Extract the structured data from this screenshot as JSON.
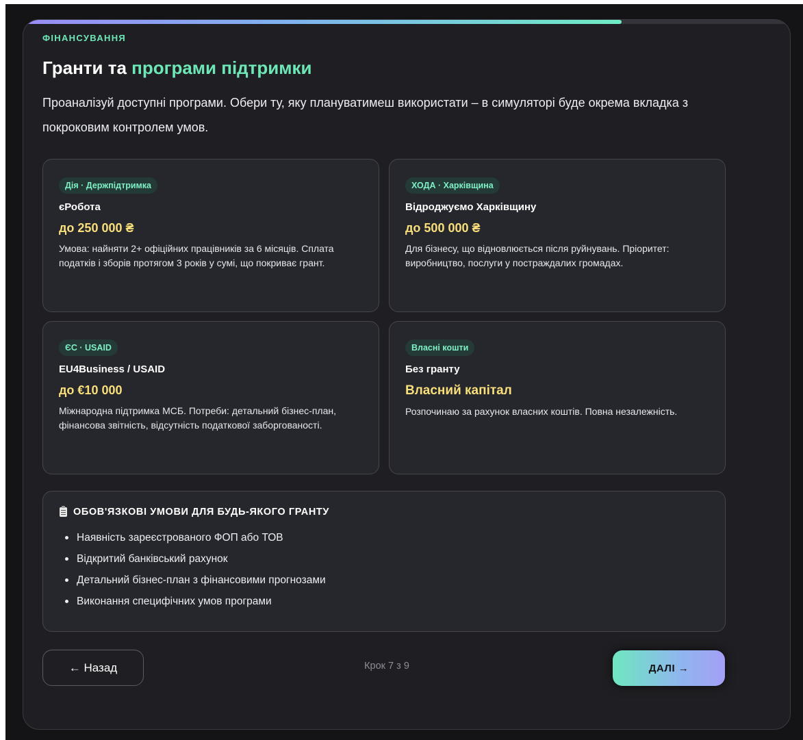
{
  "progress": {
    "fraction": 0.78
  },
  "header": {
    "eyebrow": "ФІНАНСУВАННЯ",
    "title_prefix": "Гранти та ",
    "title_accent": "програми підтримки",
    "lead": "Проаналізуй доступні програми. Обери ту, яку плануватимеш використати – в симуляторі буде окрема вкладка з покроковим контролем умов."
  },
  "options": [
    {
      "tag": "Дія · Держпідтримка",
      "name": "єРобота",
      "amount": "до 250 000 ₴",
      "desc": "Умова: найняти 2+ офіційних працівників за 6 місяців. Сплата податків і зборів протягом 3 років у сумі, що покриває грант."
    },
    {
      "tag": "ХОДА · Харківщина",
      "name": "Відроджуємо Харківщину",
      "amount": "до 500 000 ₴",
      "desc": "Для бізнесу, що відновлюється після руйнувань. Пріоритет: виробництво, послуги у постраждалих громадах."
    },
    {
      "tag": "ЄС · USAID",
      "name": "EU4Business / USAID",
      "amount": "до €10 000",
      "desc": "Міжнародна підтримка МСБ. Потреби: детальний бізнес-план, фінансова звітність, відсутність податкової заборгованості."
    },
    {
      "tag": "Власні кошти",
      "name": "Без гранту",
      "amount": "Власний капітал",
      "desc": "Розпочинаю за рахунок власних коштів. Повна незалежність."
    }
  ],
  "requirements": {
    "icon": "clipboard-icon",
    "title": "ОБОВ'ЯЗКОВІ УМОВИ ДЛЯ БУДЬ-ЯКОГО ГРАНТУ",
    "items": [
      "Наявність зареєстрованого ФОП або ТОВ",
      "Відкритий банківський рахунок",
      "Детальний бізнес-план з фінансовими прогнозами",
      "Виконання специфічних умов програми"
    ]
  },
  "footer": {
    "back_label": "← Назад",
    "step_label": "Крок 7 з 9",
    "next_label": "ДАЛІ →"
  },
  "colors": {
    "accent_green": "#6ee7b7",
    "amount_yellow": "#f8df7a",
    "card_bg": "#26272d",
    "page_bg": "#1f1f23"
  }
}
